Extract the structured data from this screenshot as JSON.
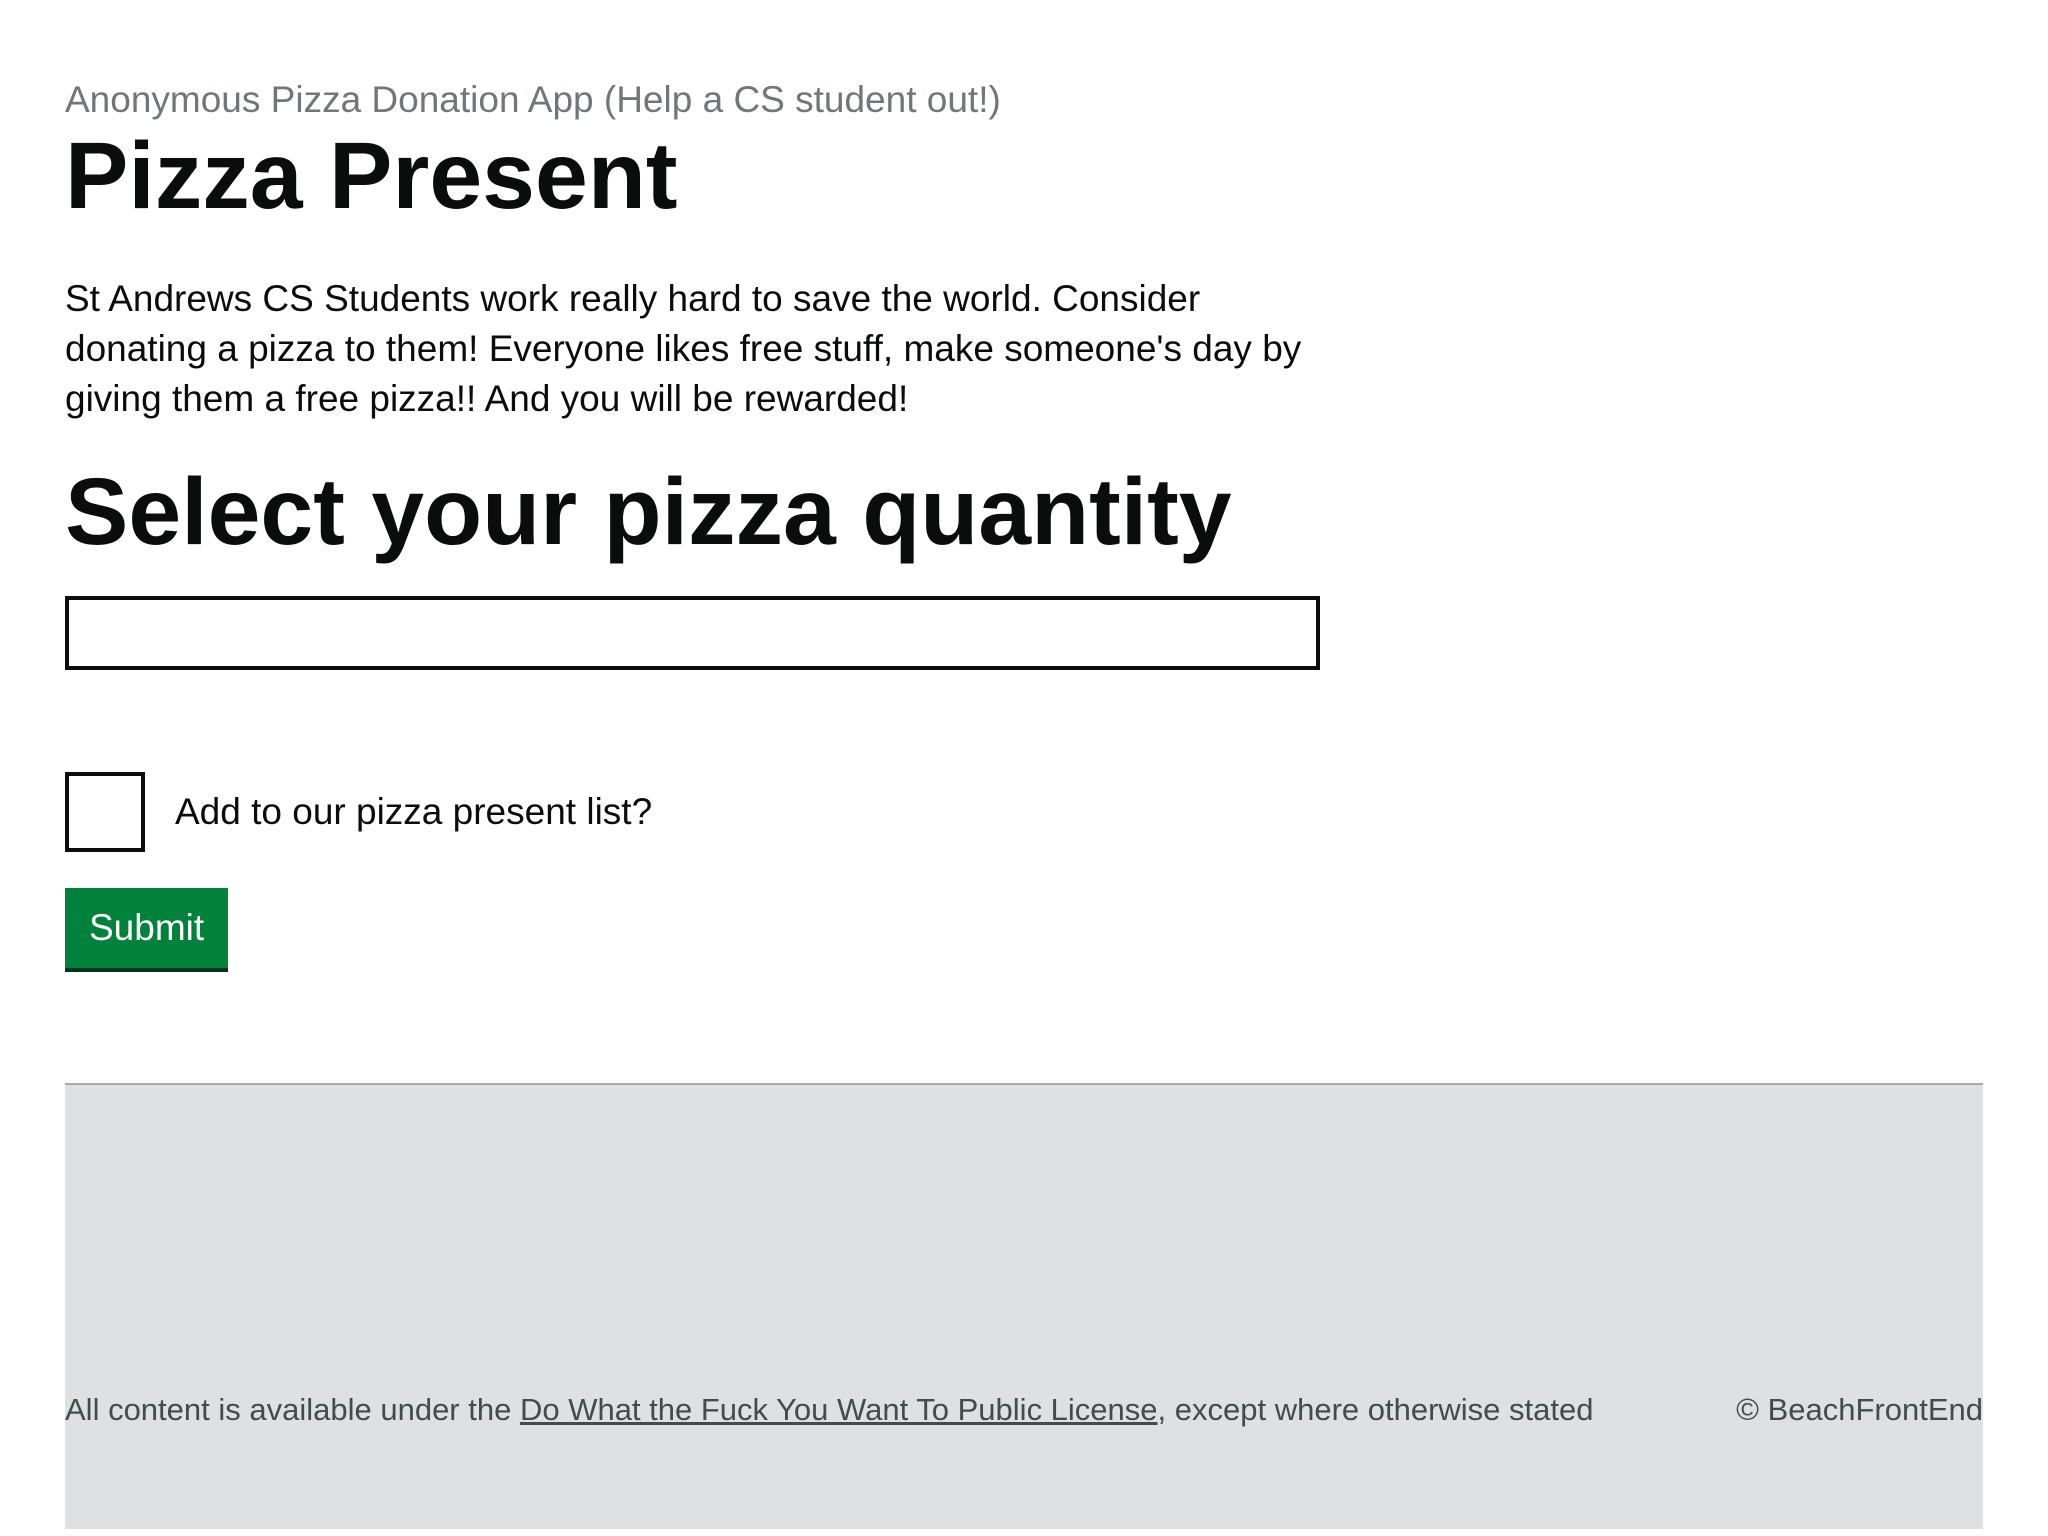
{
  "header": {
    "caption": "Anonymous Pizza Donation App (Help a CS student out!)",
    "title": "Pizza Present"
  },
  "intro": {
    "text": "St Andrews CS Students work really hard to save the world. Consider donating a pizza to them! Everyone likes free stuff, make someone's day by giving them a free pizza!! And you will be rewarded!"
  },
  "form": {
    "section_title": "Select your pizza quantity",
    "quantity_value": "",
    "checkbox_label": "Add to our pizza present list?",
    "checkbox_checked": false,
    "submit_label": "Submit"
  },
  "footer": {
    "license_prefix": "All content is available under the ",
    "license_link": "Do What the Fuck You Want To Public License",
    "license_suffix": ", except where otherwise stated",
    "copyright": "© BeachFrontEnd"
  },
  "colors": {
    "button": "#00823b",
    "footer_bg": "#dee0e2",
    "caption_text": "#6f777b"
  }
}
